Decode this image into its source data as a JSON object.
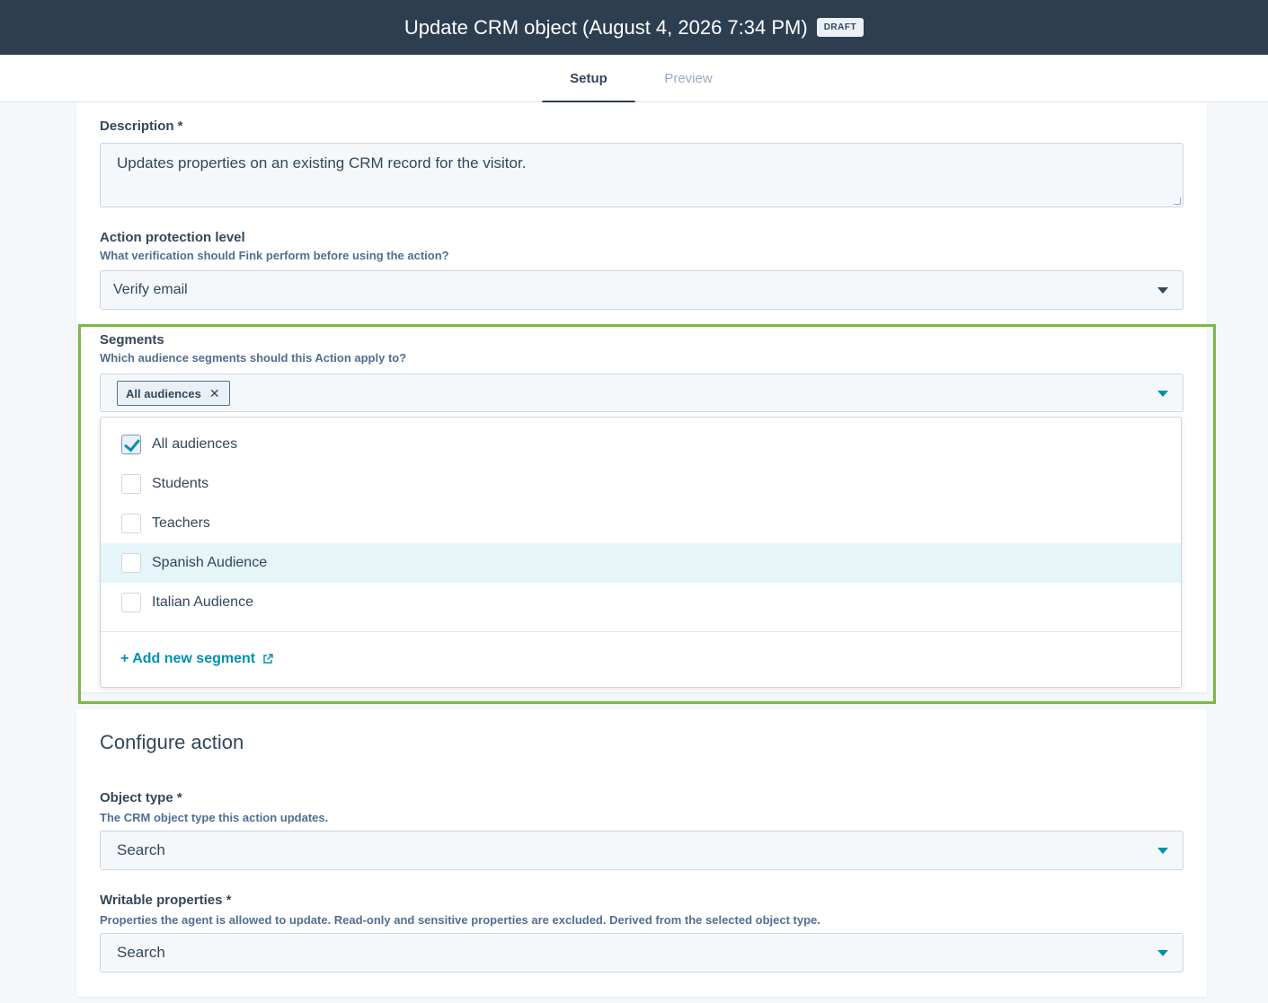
{
  "header": {
    "title": "Update CRM object (August 4, 2026 7:34 PM)",
    "badge": "DRAFT"
  },
  "tabs": [
    {
      "label": "Setup",
      "active": true
    },
    {
      "label": "Preview",
      "active": false
    }
  ],
  "description": {
    "label": "Description *",
    "value": "Updates properties on an existing CRM record for the visitor."
  },
  "protection": {
    "label": "Action protection level",
    "help": "What verification should Fink perform before using the action?",
    "value": "Verify email"
  },
  "segments": {
    "label": "Segments",
    "help": "Which audience segments should this Action apply to?",
    "selected_chip": "All audiences",
    "options": [
      {
        "label": "All audiences",
        "checked": true
      },
      {
        "label": "Students",
        "checked": false
      },
      {
        "label": "Teachers",
        "checked": false
      },
      {
        "label": "Spanish Audience",
        "checked": false,
        "hovered": true
      },
      {
        "label": "Italian Audience",
        "checked": false
      }
    ],
    "add_link": "+ Add new segment"
  },
  "configure": {
    "heading": "Configure action",
    "object_type": {
      "label": "Object type *",
      "help": "The CRM object type this action updates.",
      "placeholder": "Search"
    },
    "writable": {
      "label": "Writable properties *",
      "help": "Properties the agent is allowed to update. Read-only and sensitive properties are excluded. Derived from the selected object type.",
      "placeholder": "Search"
    }
  },
  "colors": {
    "header_bg": "#2d3e50",
    "accent": "#0091ae",
    "highlight_border": "#7bb945",
    "hover_row": "#e5f5f8"
  },
  "icons": {
    "chip_remove": "close-icon",
    "dropdown": "caret-down-icon",
    "external": "external-link-icon",
    "checkbox_check": "checkmark-icon"
  }
}
